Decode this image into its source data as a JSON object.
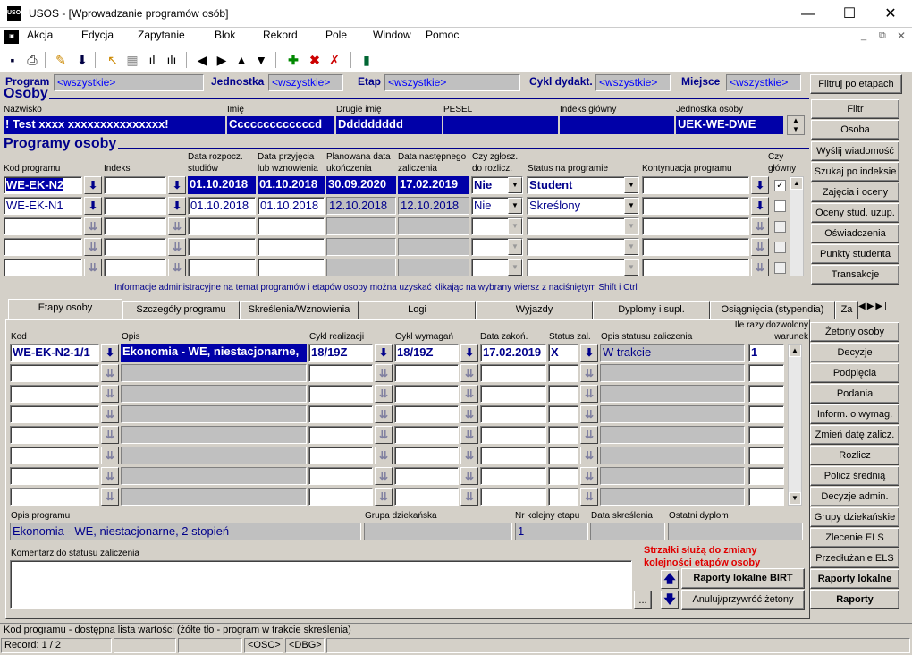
{
  "window": {
    "title": "USOS - [Wprowadzanie programów osób]",
    "app_icon": "USOS",
    "minimize": "—",
    "maximize": "☐",
    "close": "✕"
  },
  "menu": [
    "Akcja",
    "Edycja",
    "Zapytanie",
    "Blok",
    "Rekord",
    "Pole",
    "Window",
    "Pomoc"
  ],
  "filter": {
    "program_label": "Program",
    "program_value": "<wszystkie>",
    "jednostka_label": "Jednostka",
    "jednostka_value": "<wszystkie>",
    "etap_label": "Etap",
    "etap_value": "<wszystkie>",
    "cykl_label": "Cykl dydakt.",
    "cykl_value": "<wszystkie>",
    "miejsce_label": "Miejsce",
    "miejsce_value": "<wszystkie>",
    "filter_button": "Filtruj po etapach"
  },
  "osoby": {
    "title": "Osoby",
    "labels": {
      "nazwisko": "Nazwisko",
      "imie": "Imię",
      "drugie_imie": "Drugie imię",
      "pesel": "PESEL",
      "indeks": "Indeks główny",
      "jednostka": "Jednostka osoby"
    },
    "values": {
      "nazwisko": "! Test xxxx xxxxxxxxxxxxxxx!",
      "imie": "Cccccccccccccd",
      "drugie_imie": "Ddddddddd",
      "pesel": "",
      "indeks": "",
      "jednostka": "UEK-WE-DWE"
    }
  },
  "right_buttons_top": [
    "Filtr",
    "Osoba",
    "Wyślij wiadomość",
    "Szukaj po indeksie",
    "Zajęcia i oceny",
    "Oceny stud. uzup.",
    "Oświadczenia",
    "Punkty studenta",
    "Transakcje"
  ],
  "programy": {
    "title": "Programy osoby",
    "headers": {
      "kod": "Kod programu",
      "indeks": "Indeks",
      "data_rozp": "Data rozpocz.\nstudiów",
      "data_przyj": "Data przyjęcia\nlub wznowienia",
      "plan_data": "Planowana data\nukończenia",
      "data_nast": "Data następnego\nzaliczenia",
      "czy_zglosz": "Czy zgłosz.\ndo rozlicz.",
      "status": "Status na programie",
      "kontynuacja": "Kontynuacja programu",
      "czy_glowny": "Czy\ngłówny"
    },
    "rows": [
      {
        "kod": "WE-EK-N2",
        "indeks": "",
        "data_rozp": "01.10.2018",
        "data_przyj": "01.10.2018",
        "plan_data": "30.09.2020",
        "data_nast": "17.02.2019",
        "czy": "Nie",
        "status": "Student",
        "kontynuacja": "",
        "glowny": "✓"
      },
      {
        "kod": "WE-EK-N1",
        "indeks": "",
        "data_rozp": "01.10.2018",
        "data_przyj": "01.10.2018",
        "plan_data": "12.10.2018",
        "data_nast": "12.10.2018",
        "czy": "Nie",
        "status": "Skreślony",
        "kontynuacja": "",
        "glowny": ""
      }
    ],
    "info": "Informacje administracyjne na temat programów i etapów osoby można uzyskać klikając na wybrany wiersz z naciśniętym Shift i Ctrl"
  },
  "tabs": [
    "Etapy osoby",
    "Szczegóły programu",
    "Skreślenia/Wznowienia",
    "Logi",
    "Wyjazdy",
    "Dyplomy i supl.",
    "Osiągnięcia (stypendia)",
    "Za"
  ],
  "etapy": {
    "headers": {
      "kod": "Kod",
      "opis": "Opis",
      "cykl_real": "Cykl realizacji",
      "cykl_wym": "Cykl wymagań",
      "data_zak": "Data zakoń.",
      "status_zal": "Status zal.",
      "opis_status": "Opis statusu zaliczenia",
      "ile_razy": "Ile razy dozwolony\nwarunek"
    },
    "rows": [
      {
        "kod": "WE-EK-N2-1/1",
        "opis": "Ekonomia - WE, niestacjonarne,",
        "cykl_real": "18/19Z",
        "cykl_wym": "18/19Z",
        "data_zak": "17.02.2019",
        "status_zal": "X",
        "opis_status": "W trakcie",
        "ile_razy": "1"
      }
    ],
    "opis_programu_label": "Opis programu",
    "opis_programu_value": "Ekonomia - WE, niestacjonarne, 2 stopień",
    "grupa_label": "Grupa dziekańska",
    "grupa_value": "",
    "nr_label": "Nr kolejny etapu",
    "nr_value": "1",
    "data_skr_label": "Data skreślenia",
    "data_skr_value": "",
    "ostatni_label": "Ostatni dyplom",
    "ostatni_value": "",
    "komentarz_label": "Komentarz do statusu zaliczenia",
    "komentarz_value": "",
    "arrows_note": "Strzałki służą do zmiany\nkolejności etapów osoby",
    "birt_button": "Raporty lokalne BIRT",
    "anuluj_button": "Anuluj/przywróć żetony",
    "ellipsis": "..."
  },
  "right_buttons_bottom": [
    "Żetony osoby",
    "Decyzje",
    "Podpięcia",
    "Podania",
    "Inform. o wymag.",
    "Zmień datę zalicz.",
    "Rozlicz",
    "Policz średnią",
    "Decyzje admin.",
    "Grupy dziekańskie",
    "Zlecenie ELS",
    "Przedłużanie ELS",
    "Raporty lokalne",
    "Raporty"
  ],
  "status": {
    "message": "Kod programu - dostępna lista wartości (żółte tło - program w trakcie skreślenia)",
    "record": "Record: 1 / 2",
    "osc": "<OSC>",
    "dbg": "<DBG>"
  },
  "colors": {
    "selection": "#0000a8",
    "blue_text": "#0000ff",
    "section_title": "#00008b",
    "note": "#e00000"
  }
}
